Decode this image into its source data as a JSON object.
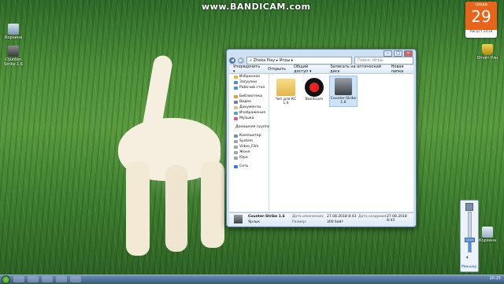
{
  "watermark": "www.BANDICAM.com",
  "calendar": {
    "weekday": "среда",
    "day": "29",
    "month_year": "Август 2018"
  },
  "desktop_icons": [
    {
      "label": "Корзина"
    },
    {
      "label": "Counter-Strike 1.6"
    }
  ],
  "right_desktop_icon": {
    "label": "Отчёт Рлн"
  },
  "recycle_bin": {
    "label": "Корзина"
  },
  "explorer": {
    "breadcrumb": "« Zheka Play ▸ Игры ▸",
    "search_placeholder": "Поиск: Игры",
    "toolbar": [
      "Упорядочить ▾",
      "Открыть",
      "Общий доступ ▾",
      "Записать на оптический диск",
      "Новая папка"
    ],
    "nav": [
      {
        "label": "Избранное",
        "color": "#e8b93a"
      },
      {
        "label": "Загрузки",
        "color": "#4f8fd8"
      },
      {
        "label": "Рабочий стол",
        "color": "#4f8fd8"
      },
      {
        "gap": true
      },
      {
        "label": "Библиотеки",
        "color": "#d8a23a"
      },
      {
        "label": "Видео",
        "color": "#7a7aa8"
      },
      {
        "label": "Документы",
        "color": "#d8c28a"
      },
      {
        "label": "Изображения",
        "color": "#5a9fd8"
      },
      {
        "label": "Музыка",
        "color": "#d85a8a"
      },
      {
        "gap": true
      },
      {
        "label": "Домашняя группа",
        "color": "#3aa0d8"
      },
      {
        "gap": true
      },
      {
        "label": "Компьютер",
        "color": "#6a8fb8"
      },
      {
        "label": "System",
        "color": "#9aa6b5"
      },
      {
        "label": "Video_Film",
        "color": "#9aa6b5"
      },
      {
        "label": "Женя",
        "color": "#9aa6b5"
      },
      {
        "label": "Юра",
        "color": "#9aa6b5"
      },
      {
        "gap": true
      },
      {
        "label": "Сеть",
        "color": "#3a7ad8"
      }
    ],
    "files": [
      {
        "label": "Чит для КС 1.6",
        "kind": "folder"
      },
      {
        "label": "Bandicam",
        "kind": "bandicam"
      },
      {
        "label": "Counter-Strike 1.6",
        "kind": "cs"
      }
    ],
    "details": {
      "name": "Counter-Strike 1.6",
      "type": "Ярлык",
      "modified_label": "Дата изменения:",
      "modified": "27.08.2018 8:43",
      "size_label": "Размер:",
      "size": "300 байт",
      "created_label": "Дата создания:",
      "created": "27.08.2018 8:43"
    }
  },
  "volume": {
    "label": "Микшер",
    "level": 0.3
  },
  "clock": "20:25"
}
